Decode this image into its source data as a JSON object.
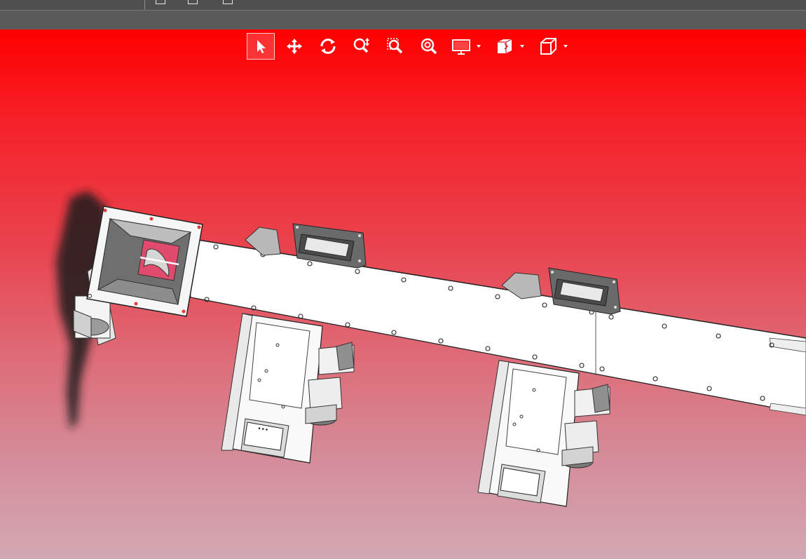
{
  "window": {
    "top_toolbar_icons": [
      "list-icon",
      "save-icon",
      "copy-icon"
    ]
  },
  "view_toolbar": {
    "tools": [
      {
        "name": "select-tool",
        "icon": "arrow-cursor-icon",
        "active": true
      },
      {
        "name": "pan-tool",
        "icon": "move-arrows-icon",
        "active": false
      },
      {
        "name": "rotate-tool",
        "icon": "rotate-icon",
        "active": false
      },
      {
        "name": "zoom-tool",
        "icon": "zoom-in-out-icon",
        "active": false
      },
      {
        "name": "zoom-window-tool",
        "icon": "zoom-window-icon",
        "active": false
      },
      {
        "name": "zoom-fit-tool",
        "icon": "zoom-fit-icon",
        "active": false
      },
      {
        "name": "display-mode-dropdown",
        "icon": "monitor-icon",
        "active": false
      },
      {
        "name": "section-view-dropdown",
        "icon": "section-view-icon",
        "active": false
      },
      {
        "name": "view-orientation-dropdown",
        "icon": "cube-icon",
        "active": false
      }
    ]
  },
  "viewport": {
    "background_top": "#ff0000",
    "background_bottom": "#d2a8b2",
    "model": "screw-conveyor-assembly"
  }
}
